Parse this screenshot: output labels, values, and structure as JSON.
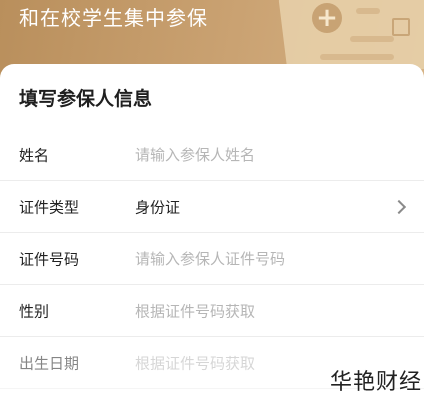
{
  "banner": {
    "text": "和在校学生集中参保"
  },
  "form": {
    "title": "填写参保人信息",
    "rows": [
      {
        "label": "姓名",
        "placeholder": "请输入参保人姓名"
      },
      {
        "label": "证件类型",
        "value": "身份证"
      },
      {
        "label": "证件号码",
        "placeholder": "请输入参保人证件号码"
      },
      {
        "label": "性别",
        "value": "根据证件号码获取"
      },
      {
        "label": "出生日期",
        "value": "根据证件号码获取"
      }
    ]
  },
  "watermark": "华艳财经",
  "colors": {
    "banner": "#caa272",
    "placeholder": "#b6b6b6",
    "text": "#222222"
  }
}
